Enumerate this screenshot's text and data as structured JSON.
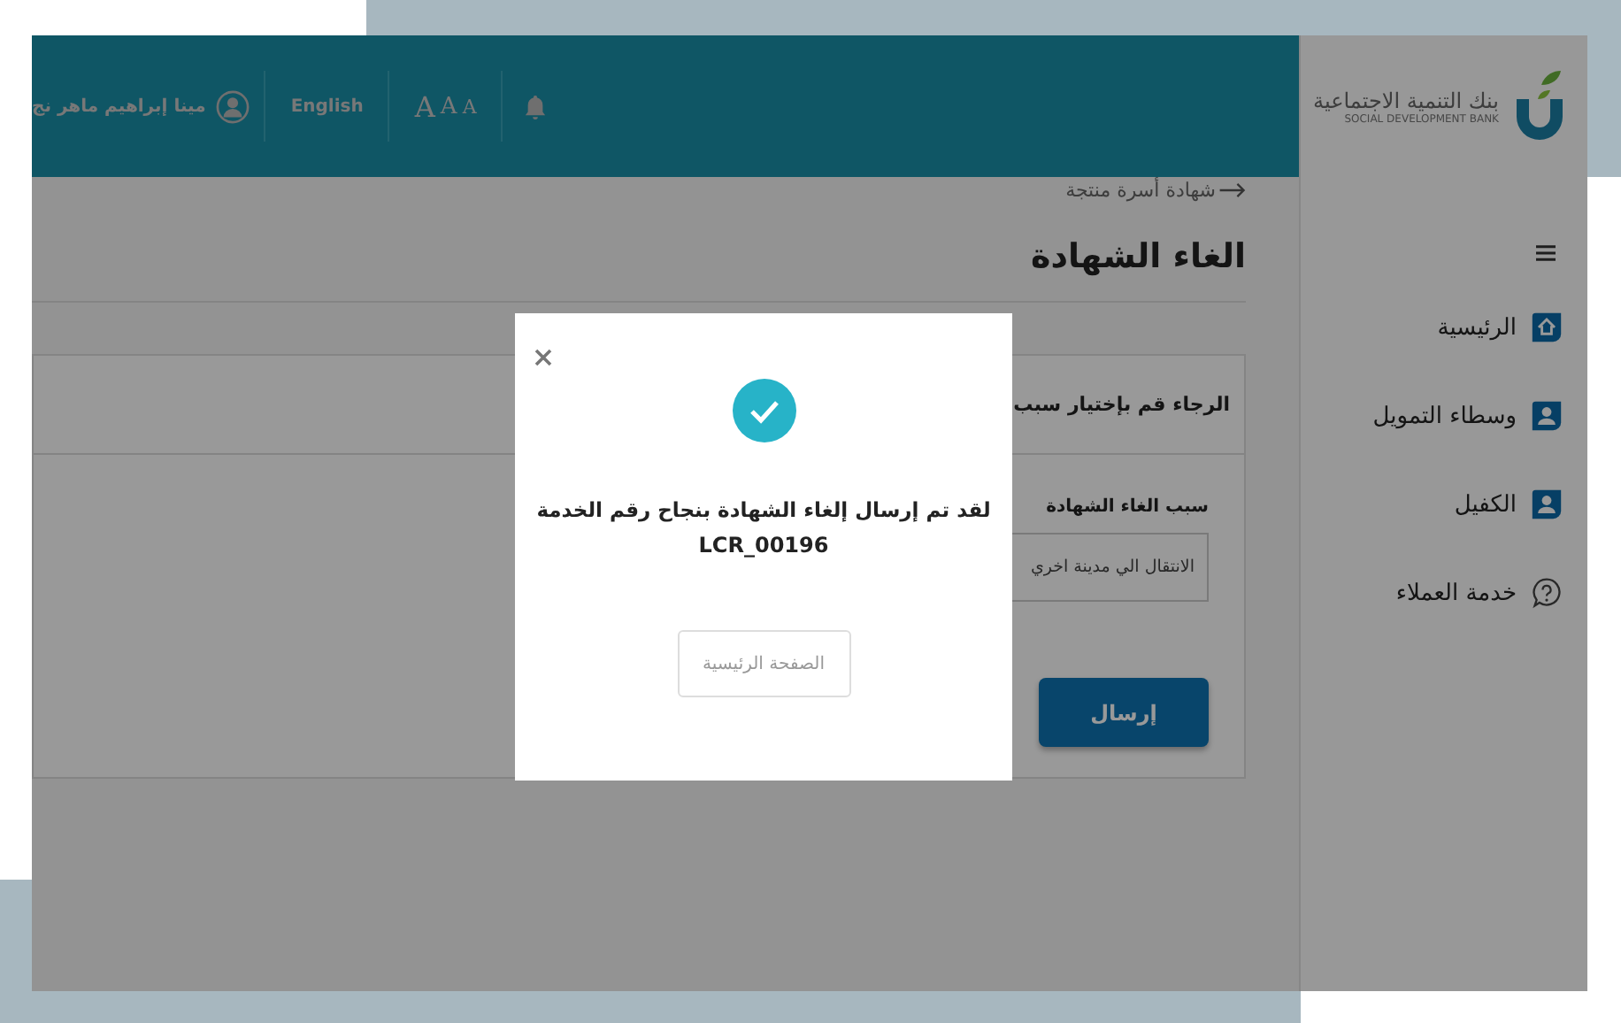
{
  "brand": {
    "name_ar": "بنك التنمية الاجتماعية",
    "name_en": "SOCIAL DEVELOPMENT BANK"
  },
  "header": {
    "font_sizes": [
      "A",
      "A",
      "A"
    ],
    "language": "English",
    "user_name": "مينا إبراهيم ماهر نج"
  },
  "sidebar": {
    "items": [
      {
        "label": "الرئيسية",
        "kind": "home"
      },
      {
        "label": "وسطاء التمويل",
        "kind": "person"
      },
      {
        "label": "الكفيل",
        "kind": "person"
      },
      {
        "label": "خدمة العملاء",
        "kind": "help"
      }
    ]
  },
  "page": {
    "breadcrumb": "شهادة أسرة منتجة",
    "title": "الغاء الشهادة"
  },
  "card": {
    "heading": "الرجاء قم بإختيار سبب",
    "reason_label": "سبب الغاء الشهادة",
    "reason_value": "الانتقال الي مدينة اخري",
    "submit": "إرسال"
  },
  "dialog": {
    "message": "لقد تم إرسال إلغاء الشهادة بنجاح رقم الخدمة",
    "code": "LCR_00196",
    "button": "الصفحة الرئيسية"
  }
}
